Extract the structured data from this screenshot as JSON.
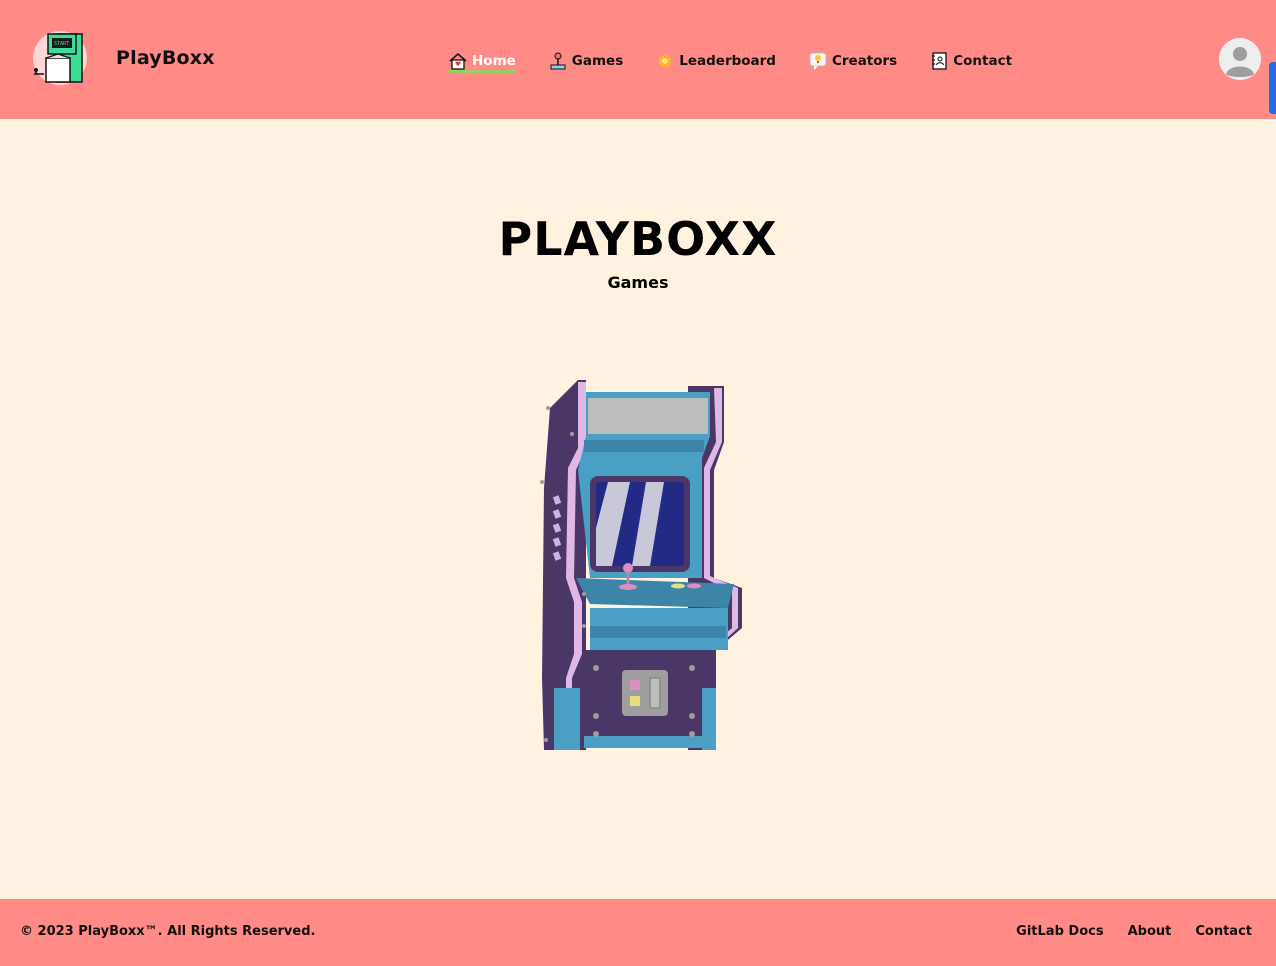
{
  "header": {
    "brand": "PlayBoxx",
    "logo_icon": "arcade-logo-icon",
    "avatar_icon": "user-avatar-icon"
  },
  "nav": {
    "items": [
      {
        "label": "Home",
        "icon": "house-heart-icon",
        "active": true
      },
      {
        "label": "Games",
        "icon": "joystick-icon",
        "active": false
      },
      {
        "label": "Leaderboard",
        "icon": "sparkle-badge-icon",
        "active": false
      },
      {
        "label": "Creators",
        "icon": "lightbulb-bubble-icon",
        "active": false
      },
      {
        "label": "Contact",
        "icon": "contact-book-icon",
        "active": false
      }
    ]
  },
  "hero": {
    "title": "PLAYBOXX",
    "subtitle": "Games",
    "illustration": "arcade-cabinet-illustration"
  },
  "footer": {
    "copyright": "© 2023 PlayBoxx™. All Rights Reserved.",
    "links": [
      "GitLab Docs",
      "About",
      "Contact"
    ]
  },
  "colors": {
    "header_bg": "#ff8a86",
    "page_bg": "#fff3e0",
    "active_underline": "#9ccc65",
    "cabinet_purple": "#4a3768",
    "cabinet_blue": "#4aa0c4"
  }
}
